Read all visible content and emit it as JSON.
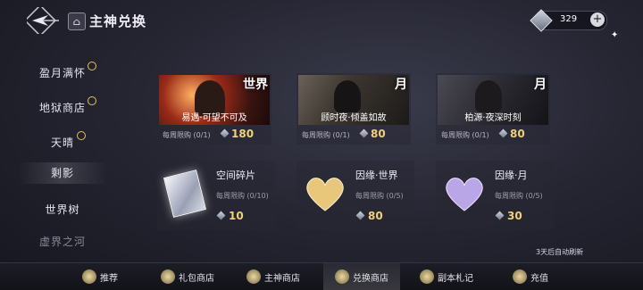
{
  "header": {
    "title": "主神兑换",
    "home_icon": "home-icon",
    "back_icon": "back-icon",
    "currency": {
      "amount": "329",
      "icon": "gem-icon",
      "add_label": "+"
    }
  },
  "sidebar": {
    "items": [
      {
        "label": "盈月满怀",
        "timed": true
      },
      {
        "label": "地狱商店",
        "timed": true
      },
      {
        "label": "天晴",
        "timed": true
      },
      {
        "label": "剩影",
        "timed": false
      },
      {
        "label": "世界树",
        "timed": false
      },
      {
        "label": "虚界之河",
        "timed": false
      }
    ]
  },
  "shop": {
    "cards": [
      {
        "name": "易遇·可望不可及",
        "tag": "世界",
        "limit": "每周限购 (0/1)",
        "price": "180"
      },
      {
        "name": "顾时夜·倾盖如故",
        "tag": "月",
        "limit": "每周限购 (0/1)",
        "price": "80"
      },
      {
        "name": "柏源·夜深时刻",
        "tag": "月",
        "limit": "每周限购 (0/1)",
        "price": "80"
      }
    ],
    "items": [
      {
        "name": "空间碎片",
        "limit": "每周限购 (0/10)",
        "price": "10"
      },
      {
        "name": "因缘·世界",
        "limit": "每周限购 (0/5)",
        "price": "80"
      },
      {
        "name": "因缘·月",
        "limit": "每周限购 (0/5)",
        "price": "30"
      }
    ],
    "refresh_note": "3天后自动刷新"
  },
  "bottom_nav": {
    "items": [
      {
        "label": "推荐"
      },
      {
        "label": "礼包商店"
      },
      {
        "label": "主神商店"
      },
      {
        "label": "兑换商店"
      },
      {
        "label": "副本札记"
      },
      {
        "label": "充值"
      }
    ]
  },
  "colors": {
    "accent_gold": "#f0d07a",
    "background": "#262633"
  }
}
